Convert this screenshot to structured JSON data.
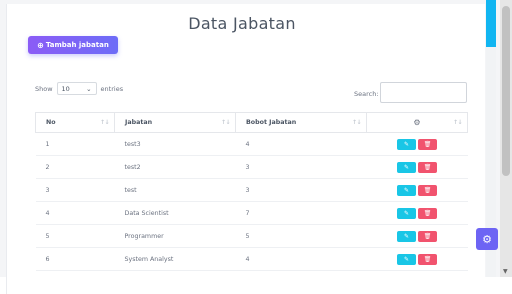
{
  "page": {
    "title": "Data Jabatan"
  },
  "toolbar": {
    "add_label": "Tambah jabatan",
    "add_icon": "plus-circle-icon"
  },
  "length": {
    "show": "Show",
    "value": "10",
    "entries": "entries"
  },
  "search": {
    "label": "Search:",
    "value": ""
  },
  "table": {
    "headers": [
      "No",
      "Jabatan",
      "Bobot Jabatan",
      ""
    ],
    "action_header_icon": "settings-icon",
    "rows": [
      {
        "no": "1",
        "jabatan": "test3",
        "bobot": "4"
      },
      {
        "no": "2",
        "jabatan": "test2",
        "bobot": "3"
      },
      {
        "no": "3",
        "jabatan": "test",
        "bobot": "3"
      },
      {
        "no": "4",
        "jabatan": "Data Scientist",
        "bobot": "7"
      },
      {
        "no": "5",
        "jabatan": "Programmer",
        "bobot": "5"
      },
      {
        "no": "6",
        "jabatan": "System Analyst",
        "bobot": "4"
      }
    ],
    "row_actions": [
      {
        "name": "edit",
        "icon": "edit-icon"
      },
      {
        "name": "delete",
        "icon": "trash-icon"
      }
    ]
  },
  "colors": {
    "primary": "#6d6cf7",
    "accent": "#19c6e6",
    "danger": "#f1536e",
    "scroll_accent": "#11b5f1"
  }
}
